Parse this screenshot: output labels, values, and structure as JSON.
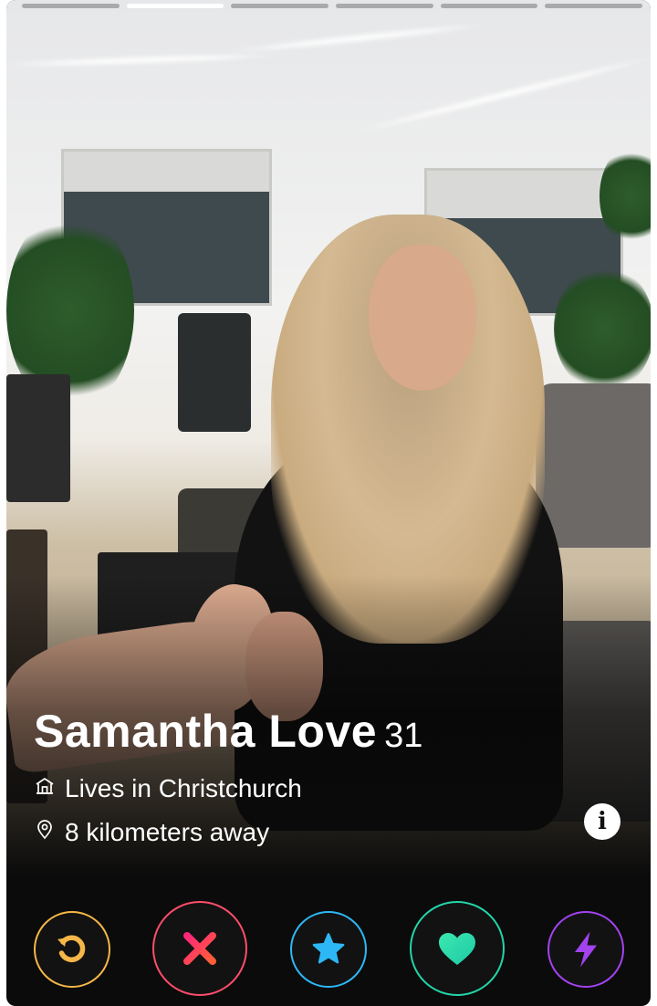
{
  "story": {
    "total": 6,
    "active_index": 1
  },
  "profile": {
    "name": "Samantha Love",
    "age": "31",
    "lives_in": "Lives in Christchurch",
    "distance": "8 kilometers away"
  },
  "info_button": {
    "label": "i"
  },
  "actions": {
    "rewind": {
      "icon": "rewind-icon",
      "color": "#f5b748"
    },
    "nope": {
      "icon": "x-icon",
      "color": "#fe4d6b"
    },
    "super_like": {
      "icon": "star-icon",
      "color": "#2db8f5"
    },
    "like": {
      "icon": "heart-icon",
      "color": "#23d6a8"
    },
    "boost": {
      "icon": "lightning-icon",
      "color": "#a243ef"
    }
  }
}
